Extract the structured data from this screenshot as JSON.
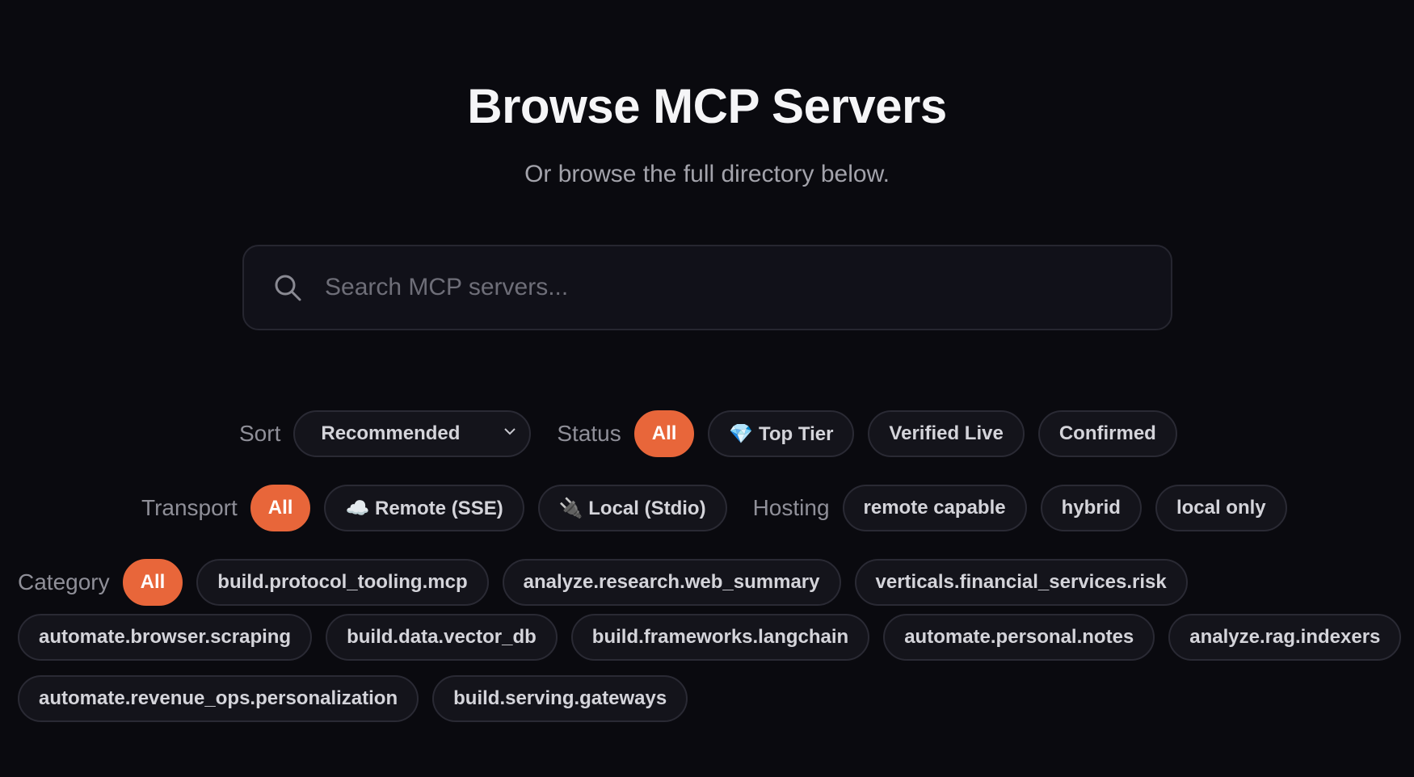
{
  "header": {
    "title": "Browse MCP Servers",
    "subtitle": "Or browse the full directory below."
  },
  "search": {
    "placeholder": "Search MCP servers...",
    "icon": "search-icon"
  },
  "sort": {
    "label": "Sort",
    "selected": "Recommended"
  },
  "status": {
    "label": "Status",
    "options": [
      "All",
      "💎 Top Tier",
      "Verified Live",
      "Confirmed"
    ],
    "selected": "All"
  },
  "transport": {
    "label": "Transport",
    "options": [
      "All",
      "☁️ Remote (SSE)",
      "🔌 Local (Stdio)"
    ],
    "selected": "All"
  },
  "hosting": {
    "label": "Hosting",
    "options": [
      "remote capable",
      "hybrid",
      "local only"
    ]
  },
  "category": {
    "label": "Category",
    "options": [
      "All",
      "build.protocol_tooling.mcp",
      "analyze.research.web_summary",
      "verticals.financial_services.risk",
      "automate.browser.scraping",
      "build.data.vector_db",
      "build.frameworks.langchain",
      "automate.personal.notes",
      "analyze.rag.indexers",
      "automate.revenue_ops.personalization",
      "build.serving.gateways"
    ],
    "selected": "All"
  },
  "colors": {
    "accent": "#e8663a",
    "background": "#0a0a0f",
    "pill_bg": "#14141b",
    "border": "#2a2a34"
  }
}
